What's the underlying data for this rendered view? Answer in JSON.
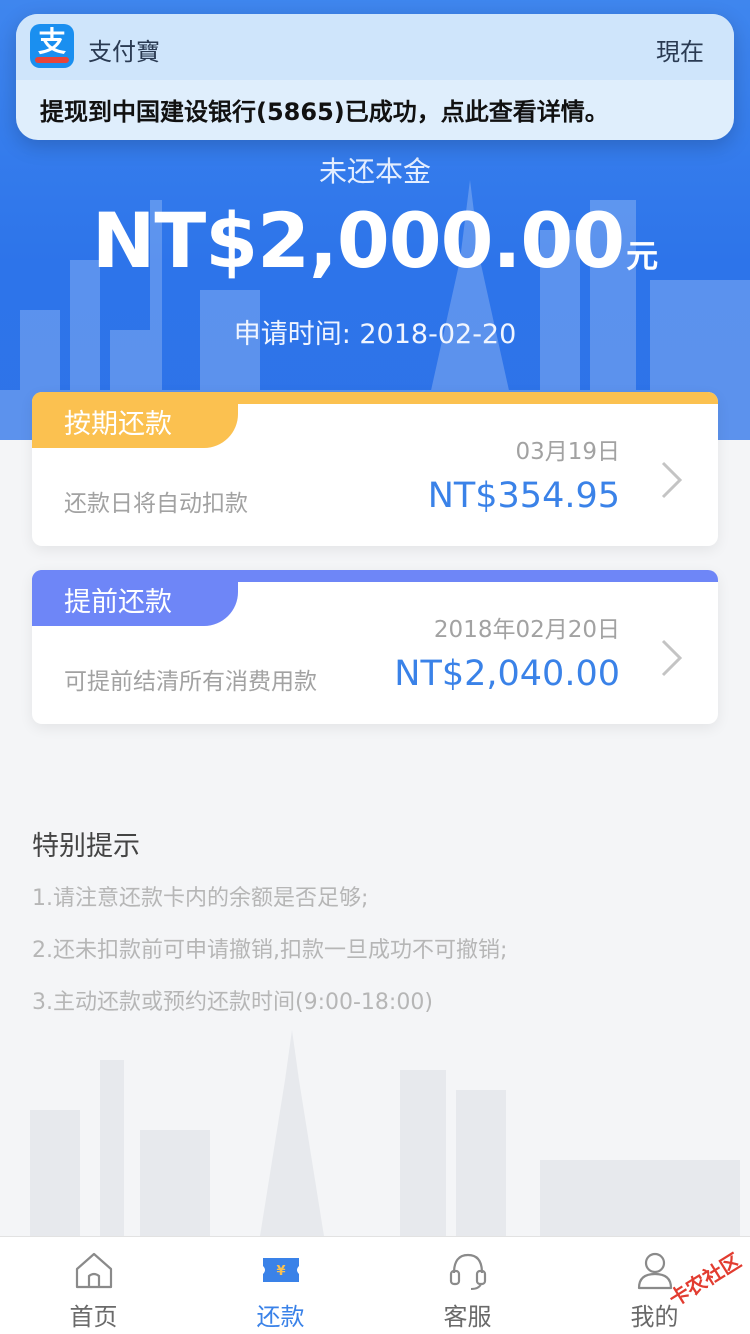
{
  "notification": {
    "app_name": "支付寶",
    "time": "現在",
    "message": "提现到中国建设银行(5865)已成功，点此查看详情。"
  },
  "hero": {
    "label": "未还本金",
    "amount": "NT$2,000.00",
    "unit": "元",
    "date": "申请时间: 2018-02-20"
  },
  "plans": [
    {
      "tag": "按期还款",
      "date": "03月19日",
      "desc": "还款日将自动扣款",
      "amount": "NT$354.95",
      "color": "#fbc150"
    },
    {
      "tag": "提前还款",
      "date": "2018年02月20日",
      "desc": "可提前结清所有消费用款",
      "amount": "NT$2,040.00",
      "color": "#6e86f7"
    }
  ],
  "tips": {
    "title": "特别提示",
    "items": [
      "1.请注意还款卡内的余额是否足够;",
      "2.还未扣款前可申请撤销,扣款一旦成功不可撤销;",
      "3.主动还款或预约还款时间(9:00-18:00)"
    ]
  },
  "tabs": [
    {
      "label": "首页",
      "icon": "home-icon",
      "active": false
    },
    {
      "label": "还款",
      "icon": "repay-ticket-icon",
      "active": true
    },
    {
      "label": "客服",
      "icon": "headset-icon",
      "active": false
    },
    {
      "label": "我的",
      "icon": "user-icon",
      "active": false
    }
  ],
  "watermark": "卡农社区",
  "colors": {
    "accent": "#3a82e8",
    "hero_blue": "#2e73e8",
    "tag_yellow": "#fbc150",
    "tag_purple": "#6e86f7"
  }
}
